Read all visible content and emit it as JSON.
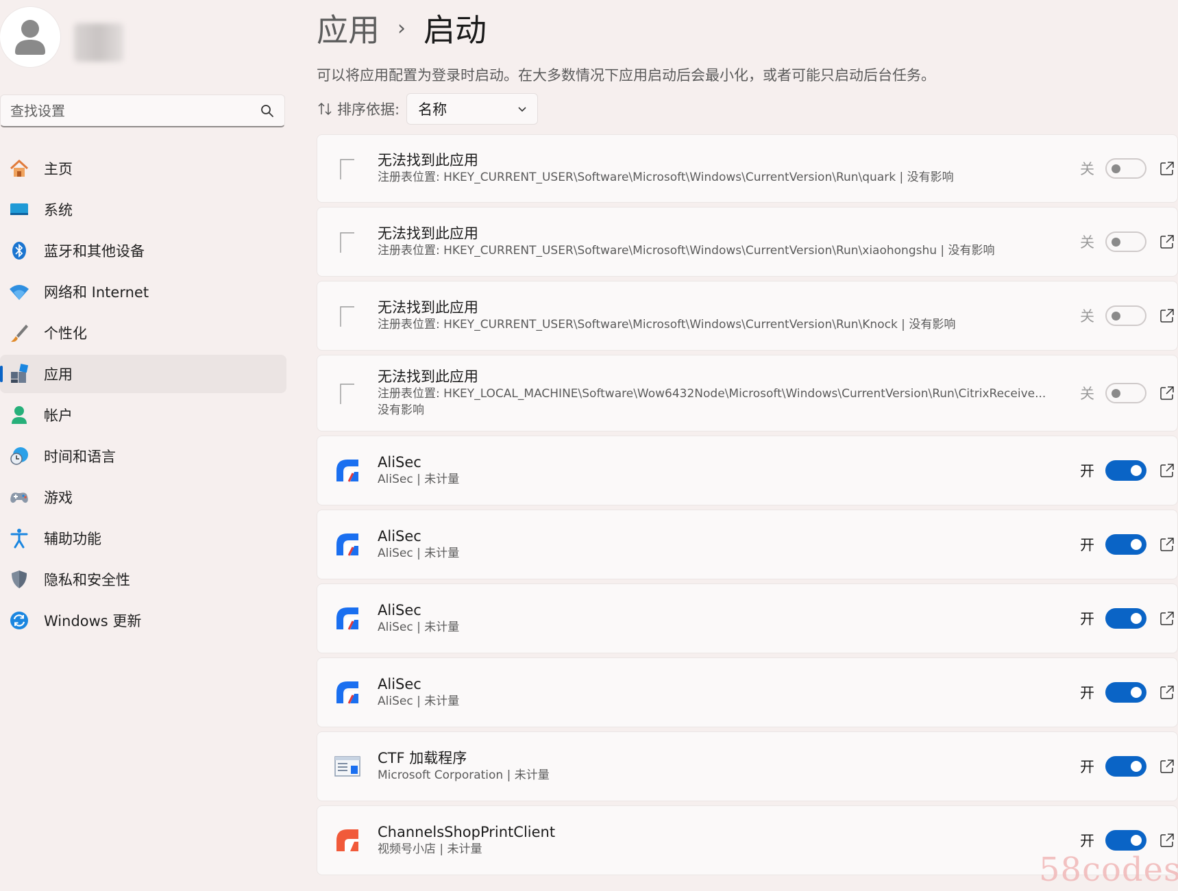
{
  "sidebar": {
    "search_placeholder": "查找设置",
    "items": [
      {
        "label": "主页",
        "icon": "home-icon",
        "active": false
      },
      {
        "label": "系统",
        "icon": "system-icon",
        "active": false
      },
      {
        "label": "蓝牙和其他设备",
        "icon": "bluetooth-icon",
        "active": false
      },
      {
        "label": "网络和 Internet",
        "icon": "wifi-icon",
        "active": false
      },
      {
        "label": "个性化",
        "icon": "brush-icon",
        "active": false
      },
      {
        "label": "应用",
        "icon": "apps-icon",
        "active": true
      },
      {
        "label": "帐户",
        "icon": "account-icon",
        "active": false
      },
      {
        "label": "时间和语言",
        "icon": "time-language-icon",
        "active": false
      },
      {
        "label": "游戏",
        "icon": "gamepad-icon",
        "active": false
      },
      {
        "label": "辅助功能",
        "icon": "accessibility-icon",
        "active": false
      },
      {
        "label": "隐私和安全性",
        "icon": "shield-icon",
        "active": false
      },
      {
        "label": "Windows 更新",
        "icon": "update-icon",
        "active": false
      }
    ]
  },
  "header": {
    "parent": "应用",
    "separator": "›",
    "current": "启动",
    "description": "可以将应用配置为登录时启动。在大多数情况下应用启动后会最小化，或者可能只启动后台任务。"
  },
  "sort": {
    "label": "排序依据:",
    "value": "名称"
  },
  "apps": [
    {
      "title": "无法找到此应用",
      "sub": "注册表位置: HKEY_CURRENT_USER\\Software\\Microsoft\\Windows\\CurrentVersion\\Run\\quark  |  没有影响",
      "sub2": "",
      "state": "关",
      "on": false,
      "icon": "blank"
    },
    {
      "title": "无法找到此应用",
      "sub": "注册表位置: HKEY_CURRENT_USER\\Software\\Microsoft\\Windows\\CurrentVersion\\Run\\xiaohongshu  |  没有影响",
      "sub2": "",
      "state": "关",
      "on": false,
      "icon": "blank"
    },
    {
      "title": "无法找到此应用",
      "sub": "注册表位置: HKEY_CURRENT_USER\\Software\\Microsoft\\Windows\\CurrentVersion\\Run\\Knock  |  没有影响",
      "sub2": "",
      "state": "关",
      "on": false,
      "icon": "blank"
    },
    {
      "title": "无法找到此应用",
      "sub": "注册表位置: HKEY_LOCAL_MACHINE\\Software\\Wow6432Node\\Microsoft\\Windows\\CurrentVersion\\Run\\CitrixReceive...  |",
      "sub2": "没有影响",
      "state": "关",
      "on": false,
      "icon": "blank"
    },
    {
      "title": "AliSec",
      "sub": "AliSec  |  未计量",
      "sub2": "",
      "state": "开",
      "on": true,
      "icon": "alisec"
    },
    {
      "title": "AliSec",
      "sub": "AliSec  |  未计量",
      "sub2": "",
      "state": "开",
      "on": true,
      "icon": "alisec"
    },
    {
      "title": "AliSec",
      "sub": "AliSec  |  未计量",
      "sub2": "",
      "state": "开",
      "on": true,
      "icon": "alisec"
    },
    {
      "title": "AliSec",
      "sub": "AliSec  |  未计量",
      "sub2": "",
      "state": "开",
      "on": true,
      "icon": "alisec"
    },
    {
      "title": "CTF 加载程序",
      "sub": "Microsoft Corporation  |  未计量",
      "sub2": "",
      "state": "开",
      "on": true,
      "icon": "ctf"
    },
    {
      "title": "ChannelsShopPrintClient",
      "sub": "视频号小店  |  未计量",
      "sub2": "",
      "state": "开",
      "on": true,
      "icon": "channels"
    }
  ],
  "watermark": "58codes",
  "colors": {
    "accent": "#0a64c6",
    "background": "#f6efee"
  }
}
